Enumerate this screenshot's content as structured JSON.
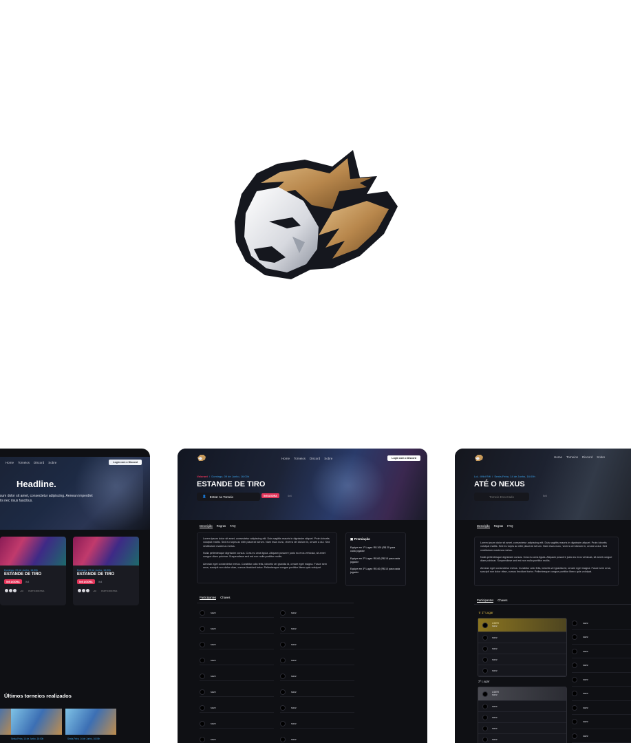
{
  "colors": {
    "background": "#ffffff",
    "mockup_bg": "#0f1014",
    "accent_red": "#e2355a",
    "accent_blue": "#3aa0e8",
    "gold": "#c89a5a"
  },
  "nav": {
    "home": "Home",
    "torneios": "Torneios",
    "discord": "Discord",
    "sobre": "Sobre",
    "login": "Login com o Discord"
  },
  "left": {
    "headline": "Headline.",
    "hero_text": "ipsum dolor sit amet, consectetur adipiscing. Aenean imperdiet felis nec risus faucibus.",
    "cards": [
      {
        "date": "Domingo, 09 de Junho, 16:00h",
        "name": "ESTANDE DE TIRO",
        "status": "5v5 AGORA",
        "mode": "4v4",
        "count": "+40",
        "participants": "PARTICIPANTES"
      },
      {
        "date": "Domingo, 09 de Junho, 16:00h",
        "name": "ESTANDE DE TIRO",
        "status": "5v5 AGORA",
        "mode": "4v4",
        "count": "+40",
        "participants": "PARTICIPANTES"
      }
    ],
    "past_title": "Últimos torneios realizados",
    "past_caption": "Sexta-Feira, 14 de Junho, 16:00h"
  },
  "center": {
    "game": "Valorant",
    "date": "Domingo, 09 de Junho, 16:00h",
    "title": "ESTANDE DE TIRO",
    "join": "Entrar no Torneio",
    "status": "5v5 AGORA",
    "mode": "4v4",
    "tabs": [
      "Descrição",
      "Regras",
      "FAQ"
    ],
    "desc": [
      "Lorem ipsum dolor sit amet, consectetur adipiscing elit. Duis sagittis mauris in dignissim aliquet. Proin lobortis volutpat mattis. Sed eu turpis ac nibh placerat rutrum. Nam risus nunc, viverra vel dictum in, ornare a dui. Sed vestibulum maximus metus.",
      "Nulla pellentesque dignissim cursus. Cras eu urna ligula. Aliquam posuere justo eu eros vehicula, sit amet congue diam pulvinar. Suspendisse sed est non nulla porttitor mollis.",
      "Aenean eget consectetur metus. Curabitur odio felis, lobortis vel gravida id, ornare eget magna. Fusce sem urna, suscipit non dolor vitae, cursus tincidunt tortor. Pellentesque congue porttitor libero quis volutpat."
    ],
    "prize_title": "Premiação",
    "prizes": [
      "Equipe em 1º Lugar: R$ 100 (R$ 25 para cada jogador",
      "Equipe em 2º Lugar: R$ 60 (R$ 15 para cada jogador",
      "Equipe em 3º Lugar: R$ 40 (R$ 10 para cada jogador"
    ],
    "sub_tabs": [
      "Participantes",
      "Chaves"
    ],
    "player": "sazz"
  },
  "right": {
    "game": "LoL: Wild Rift",
    "date": "Sexta-Feira, 14 de Junho, 16:00h",
    "title": "ATÉ O NEXUS",
    "ended": "Torneio Encerrado",
    "mode": "5v5",
    "tabs": [
      "Descrição",
      "Regras",
      "FAQ"
    ],
    "desc": [
      "Lorem ipsum dolor sit amet, consectetur adipiscing elit. Duis sagittis mauris in dignissim aliquet. Proin lobortis volutpat mattis. Sed eu turpis ac nibh placerat rutrum. Nam risus nunc, viverra vel dictum in, ornare a dui. Sed vestibulum maximus metus.",
      "Nulla pellentesque dignissim cursus. Cras eu urna ligula. Aliquam posuere justo eu eros vehicula, sit amet congue diam pulvinar. Suspendisse sed est non nulla porttitor mollis.",
      "Aenean eget consectetur metus. Curabitur odio felis, lobortis vel gravida id, ornare eget magna. Fusce sem urna, suscipit non dolor vitae, cursus tincidunt tortor. Pellentesque congue porttitor libero quis volutpat."
    ],
    "sub_tabs": [
      "Participantes",
      "Chaves"
    ],
    "first_place": "1º Lugar",
    "second_place": "2º Lugar",
    "leader": "LIDER",
    "player": "sazz"
  }
}
